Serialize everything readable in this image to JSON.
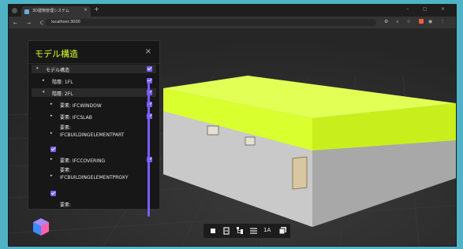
{
  "browser": {
    "tab_title": "3D建物管理システム",
    "tab_close": "×",
    "new_tab": "+",
    "url": "localhost:3000",
    "nav_icons": "← → C ⓘ",
    "window_controls": "– ◻ ×"
  },
  "panel": {
    "title": "モデル構造",
    "close": "×",
    "items": [
      {
        "label": "モデル構造",
        "caret": "▾",
        "checked": true
      },
      {
        "label": "階層: 1FL",
        "caret": "▸",
        "checked": true
      },
      {
        "label": "階層: 2FL",
        "caret": "▾",
        "checked": true
      },
      {
        "label": "要素: IFCWINDOW",
        "caret": "▸",
        "checked": true
      },
      {
        "label": "要素: IFCSLAB",
        "caret": "▸",
        "checked": true
      },
      {
        "label": "要素: IFCBUILDINGELEMENTPART",
        "caret": "▸",
        "checked": true
      },
      {
        "label": "要素: IFCCOVERING",
        "caret": "▸",
        "checked": true
      },
      {
        "label": "要素: IFCBUILDINGELEMENTPROXY",
        "caret": "▸",
        "checked": true
      },
      {
        "label": "要素: IFCDISTRIBUTIONFLOWELEMENT",
        "caret": "▸",
        "checked": true
      }
    ]
  },
  "toolbar": {
    "icons": [
      "box-icon",
      "clipboard-icon",
      "tree-icon",
      "list-icon",
      "measure-icon",
      "layers-icon"
    ],
    "measure_label": "1A"
  },
  "colors": {
    "highlight": "#d9ff2e",
    "accent": "#7b5cff",
    "background": "#4fb3c5"
  }
}
